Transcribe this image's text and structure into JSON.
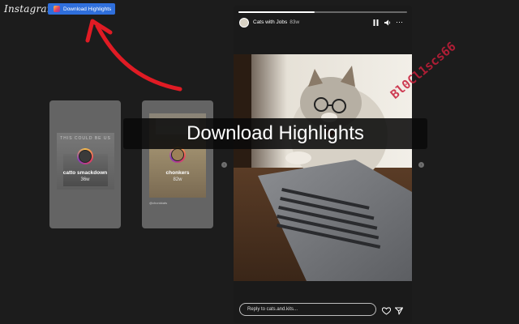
{
  "header": {
    "logo_text": "Instagram",
    "download_button_label": "Download Highlights",
    "accent_color": "#2f6fdc",
    "arrow_color": "#e01b24"
  },
  "highlights": [
    {
      "overlay_text": "THIS COULD BE US",
      "name": "catto smackdown",
      "age": "36w"
    },
    {
      "name": "chonkers",
      "age": "82w",
      "caption": "@chonkkats"
    }
  ],
  "nav": {
    "prev_icon": "chevron-left-icon",
    "next_icon": "chevron-right-icon"
  },
  "story": {
    "account_name": "Cats with Jobs",
    "time_ago": "83w",
    "progress_fraction": 0.45,
    "pause_icon": "pause-icon",
    "mute_icon": "volume-icon",
    "more_icon": "more-icon",
    "reply_placeholder": "Reply to cats.and.kits...",
    "like_icon": "heart-icon",
    "share_icon": "send-icon"
  },
  "banner_text": "Download Highlights",
  "watermark_text": "Bl0Cl1scs66"
}
